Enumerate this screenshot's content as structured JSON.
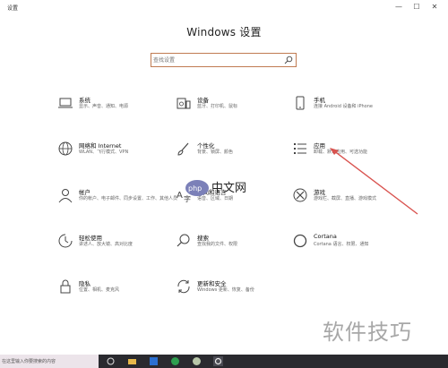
{
  "window": {
    "title": "设置",
    "controls": {
      "minimize": "—",
      "maximize": "☐",
      "close": "✕"
    }
  },
  "page_title": "Windows 设置",
  "search": {
    "placeholder": "查找设置"
  },
  "tiles": [
    {
      "title": "系统",
      "desc": "显示、声音、通知、电源",
      "icon": "laptop-icon"
    },
    {
      "title": "设备",
      "desc": "蓝牙、打印机、鼠标",
      "icon": "devices-icon"
    },
    {
      "title": "手机",
      "desc": "连接 Android 设备和 iPhone",
      "icon": "phone-icon"
    },
    {
      "title": "网络和 Internet",
      "desc": "WLAN、飞行模式、VPN",
      "icon": "globe-icon"
    },
    {
      "title": "个性化",
      "desc": "背景、锁屏、颜色",
      "icon": "brush-icon"
    },
    {
      "title": "应用",
      "desc": "卸载、默认应用、可选功能",
      "icon": "apps-list-icon"
    },
    {
      "title": "帐户",
      "desc": "你的帐户、电子邮件、同步设置、工作、其他人员",
      "icon": "person-icon"
    },
    {
      "title": "时间和语言",
      "desc": "语音、区域、日期",
      "icon": "time-language-icon"
    },
    {
      "title": "游戏",
      "desc": "游戏栏、截屏、直播、游戏模式",
      "icon": "xbox-icon"
    },
    {
      "title": "轻松使用",
      "desc": "讲述人、放大镜、高对比度",
      "icon": "ease-of-access-icon"
    },
    {
      "title": "搜索",
      "desc": "查找我的文件、权限",
      "icon": "search-icon"
    },
    {
      "title": "Cortana",
      "desc": "Cortana 语言、权限、通知",
      "icon": "cortana-icon"
    },
    {
      "title": "隐私",
      "desc": "位置、相机、麦克风",
      "icon": "lock-icon"
    },
    {
      "title": "更新和安全",
      "desc": "Windows 更新、恢复、备份",
      "icon": "update-icon"
    }
  ],
  "taskbar": {
    "left_text": "在这里输入你要搜索的内容"
  },
  "watermarks": {
    "php_text": "php",
    "cn_text": "中文网",
    "bottom_text": "软件技巧"
  },
  "colors": {
    "accent": "#c07b52",
    "annotation": "#d9534f",
    "taskbar": "#2a2a2f"
  }
}
